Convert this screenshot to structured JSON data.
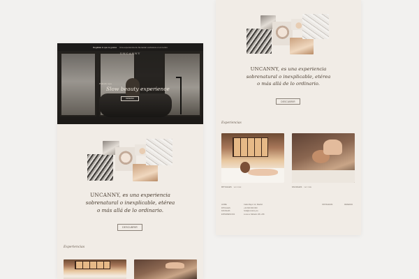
{
  "topbar": {
    "announce": "Regálate lo que te gustes",
    "sub": "Una experiencia de bienestar exclusiva en el centro"
  },
  "hero": {
    "logo": "UNCANNY",
    "kicker": "Holistic spa",
    "tagline": "Slow beauty experience",
    "cta": "RESERVA"
  },
  "statement": {
    "brand": "UNCANNY,",
    "line1": "es una experiencia",
    "line2": "sobrenatural o inexplicable, etérea",
    "line3": "o más allá de lo ordinario."
  },
  "discover_button": "DESCUBRIR",
  "experiences": {
    "heading": "Experiencias",
    "items": [
      {
        "name": "RITUALES",
        "more": "ver más"
      },
      {
        "name": "FACIALES",
        "more": "ver más"
      }
    ]
  },
  "footer": {
    "col1": [
      "HOME",
      "RITUALES",
      "FACIALES",
      "EXPERIENCIAS"
    ],
    "col2": [
      "Calle Mayor 12, Madrid",
      "+34 600 000 000",
      "hola@uncanny.es",
      "Lunes a Sábado 10h–20h"
    ],
    "col3": "INSTAGRAM",
    "col4": "RESERVA"
  },
  "colors": {
    "background": "#f2f1ef",
    "page": "#f1ece6",
    "hero": "#262422",
    "text": "#4a3d30"
  }
}
